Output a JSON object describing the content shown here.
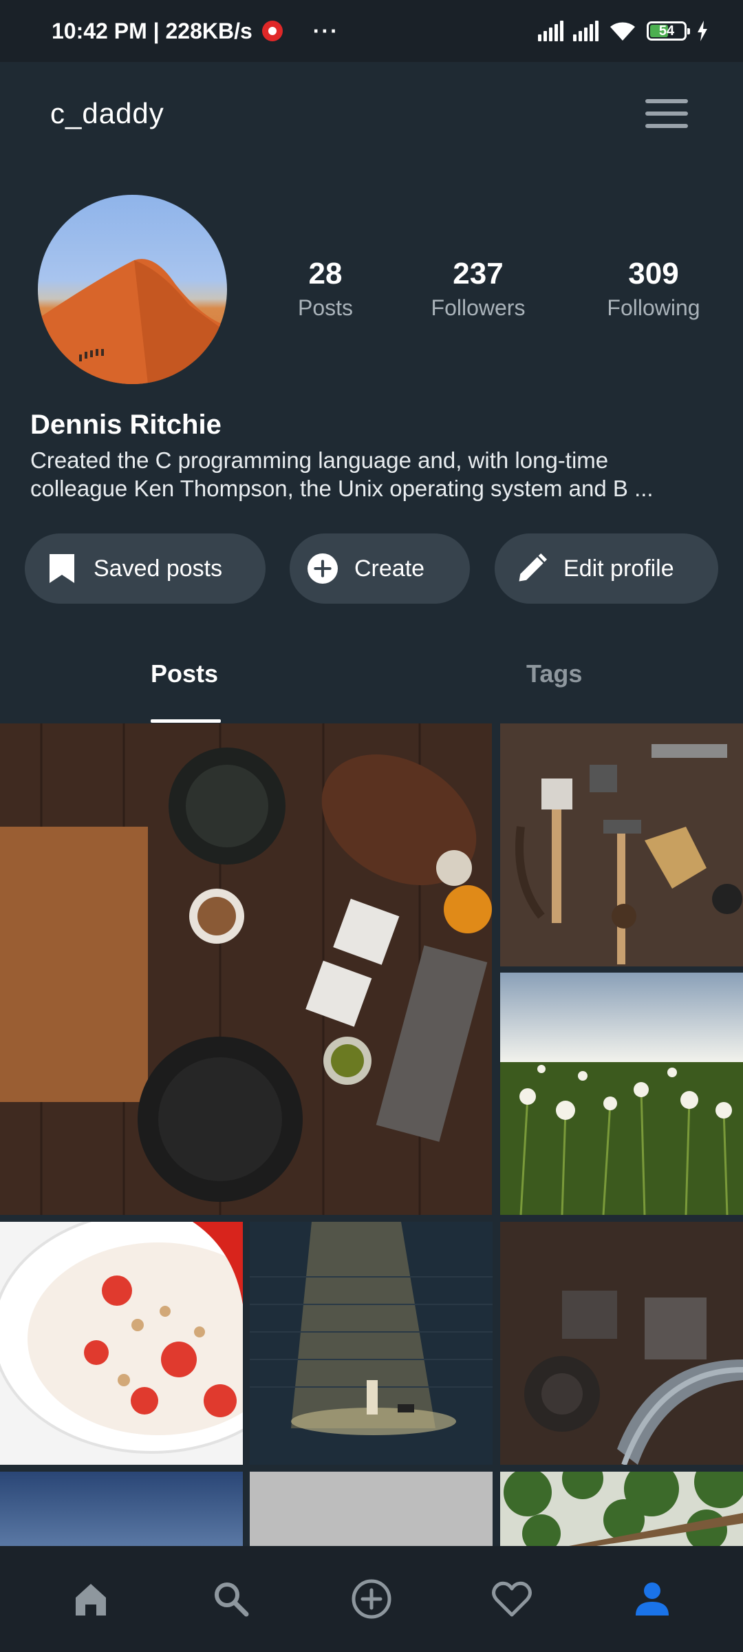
{
  "status_bar": {
    "time_speed": "10:42 PM | 228KB/s",
    "more": "···",
    "battery": "54"
  },
  "header": {
    "username": "c_daddy"
  },
  "profile": {
    "stats": [
      {
        "value": "28",
        "label": "Posts"
      },
      {
        "value": "237",
        "label": "Followers"
      },
      {
        "value": "309",
        "label": "Following"
      }
    ],
    "name": "Dennis Ritchie",
    "bio": "Created the C programming language and, with long-time colleague Ken Thompson, the Unix operating system and B ..."
  },
  "actions": {
    "saved": "Saved posts",
    "create": "Create",
    "edit": "Edit profile"
  },
  "tabs": {
    "posts": "Posts",
    "tags": "Tags"
  },
  "colors": {
    "background": "#1f2a33",
    "pill": "#37434d",
    "accent": "#1a73e8",
    "muted": "#aab3ba"
  },
  "nav": [
    "home-icon",
    "search-icon",
    "add-circle-icon",
    "heart-icon",
    "person-icon"
  ]
}
